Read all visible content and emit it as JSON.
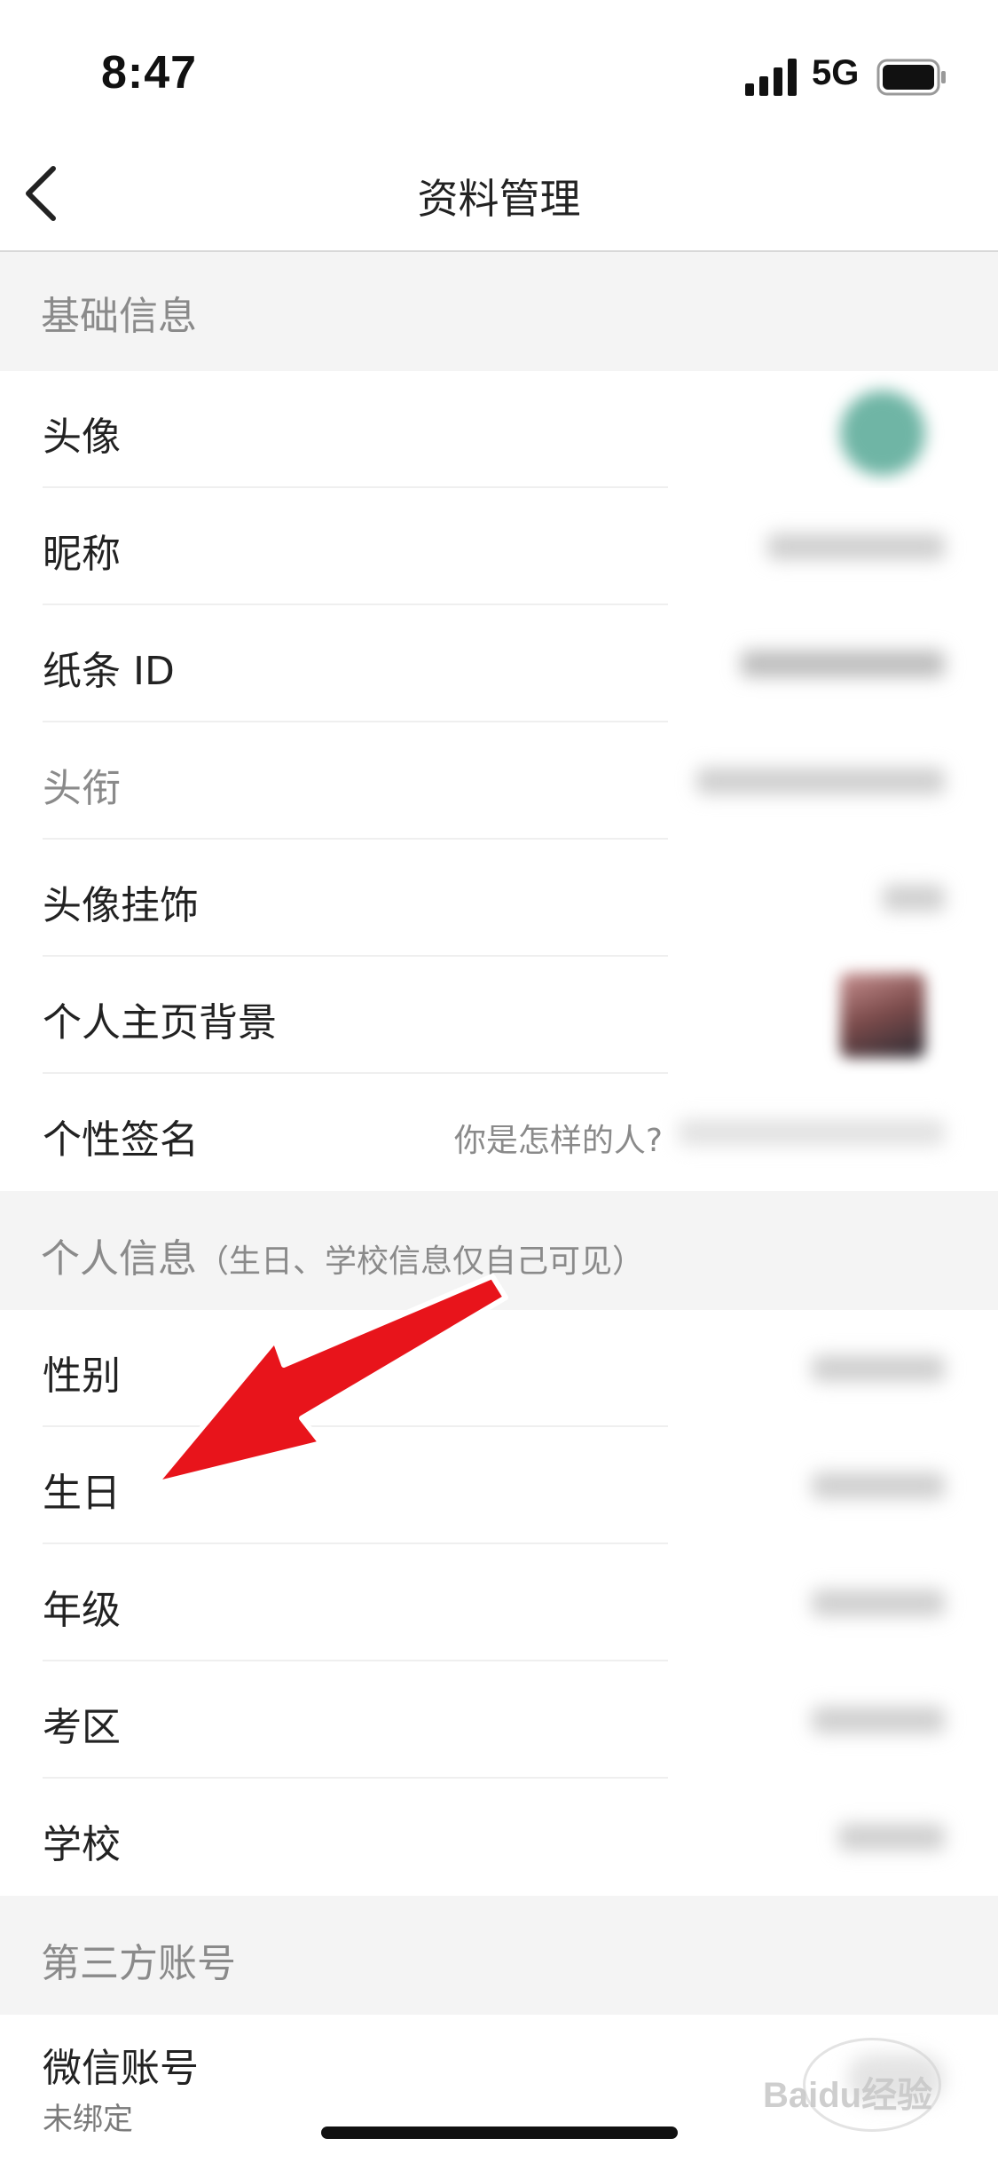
{
  "status_bar": {
    "time": "8:47",
    "network": "5G",
    "signal_icon": "cellular-signal-icon",
    "battery_icon": "battery-icon"
  },
  "nav": {
    "title": "资料管理",
    "back_icon": "chevron-left-icon"
  },
  "sections": {
    "basic": {
      "title": "基础信息"
    },
    "personal": {
      "title": "个人信息",
      "note": "（生日、学校信息仅自己可见）"
    },
    "third_party": {
      "title": "第三方账号"
    }
  },
  "rows": {
    "avatar": "头像",
    "nickname": "昵称",
    "zhitiao_id": "纸条 ID",
    "title": "头衔",
    "avatar_pendant": "头像挂饰",
    "profile_background": "个人主页背景",
    "signature": "个性签名",
    "signature_hint": "你是怎样的人?",
    "gender": "性别",
    "birthday": "生日",
    "grade": "年级",
    "exam_region": "考区",
    "school": "学校",
    "wechat": "微信账号",
    "wechat_status": "未绑定"
  },
  "annotation": {
    "arrow_color": "#e8141b"
  },
  "watermark": {
    "text": "Baidu经验"
  }
}
